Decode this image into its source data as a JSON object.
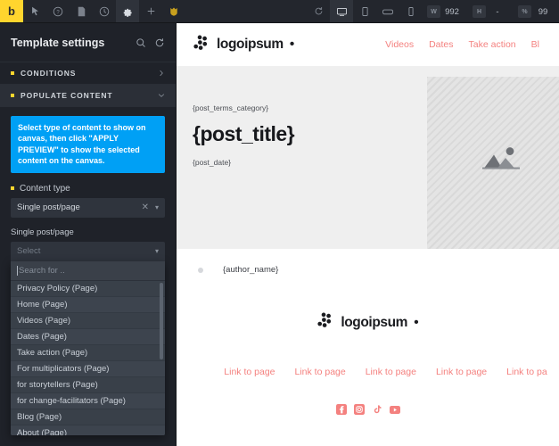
{
  "toolbar": {
    "logo_label": "b",
    "tools": [
      {
        "name": "cursor-icon",
        "title": "Select"
      },
      {
        "name": "help-icon",
        "title": "Help"
      },
      {
        "name": "page-icon",
        "title": "Pages"
      },
      {
        "name": "history-icon",
        "title": "History"
      },
      {
        "name": "gear-icon",
        "title": "Settings",
        "active": true
      },
      {
        "name": "plus-icon",
        "title": "Add"
      },
      {
        "name": "shield-icon",
        "title": "Badge"
      }
    ],
    "right_tools": [
      {
        "name": "reload-icon",
        "title": "Reload"
      },
      {
        "name": "desktop-icon",
        "title": "Desktop",
        "active": true
      },
      {
        "name": "tablet-portrait-icon",
        "title": "Tablet portrait"
      },
      {
        "name": "mobile-landscape-icon",
        "title": "Mobile landscape"
      },
      {
        "name": "mobile-portrait-icon",
        "title": "Mobile portrait"
      }
    ],
    "width_label": "W",
    "width_value": "992",
    "height_label": "H",
    "height_value": "-",
    "zoom_label": "%",
    "zoom_value": "99"
  },
  "sidebar": {
    "title": "Template settings",
    "header_icons": [
      {
        "name": "search-icon"
      },
      {
        "name": "refresh-icon"
      }
    ],
    "sections": [
      {
        "label": "CONDITIONS",
        "open": false
      },
      {
        "label": "POPULATE CONTENT",
        "open": true
      }
    ],
    "notice": "Select type of content to show on canvas, then click \"APPLY PREVIEW\" to show the selected content on the canvas.",
    "content_type_label": "Content type",
    "content_type_value": "Single post/page",
    "single_post_label": "Single post/page",
    "single_post_placeholder": "Select",
    "search_placeholder": "Search for ..",
    "options": [
      "Privacy Policy (Page)",
      "Home (Page)",
      "Videos (Page)",
      "Dates (Page)",
      "Take action (Page)",
      "For multiplicators (Page)",
      "for storytellers (Page)",
      "for change-facilitators (Page)",
      "Blog (Page)",
      "About (Page)"
    ]
  },
  "canvas": {
    "brand": "logoipsum",
    "brand_mark": "•",
    "nav": [
      "Videos",
      "Dates",
      "Take action",
      "Bl"
    ],
    "post_category": "{post_terms_category}",
    "post_title": "{post_title}",
    "post_date": "{post_date}",
    "author_name": "{author_name}",
    "footer_links": [
      "Link to page",
      "Link to page",
      "Link to page",
      "Link to page",
      "Link to pa"
    ],
    "socials": [
      {
        "name": "facebook-icon"
      },
      {
        "name": "instagram-icon"
      },
      {
        "name": "tiktok-icon"
      },
      {
        "name": "youtube-icon"
      }
    ]
  },
  "colors": {
    "accent_yellow": "#ffd52e",
    "notice_blue": "#00a0f5",
    "link_coral": "#f4817f",
    "sidebar_bg": "#1f2229",
    "toolbar_bg": "#23262d"
  }
}
